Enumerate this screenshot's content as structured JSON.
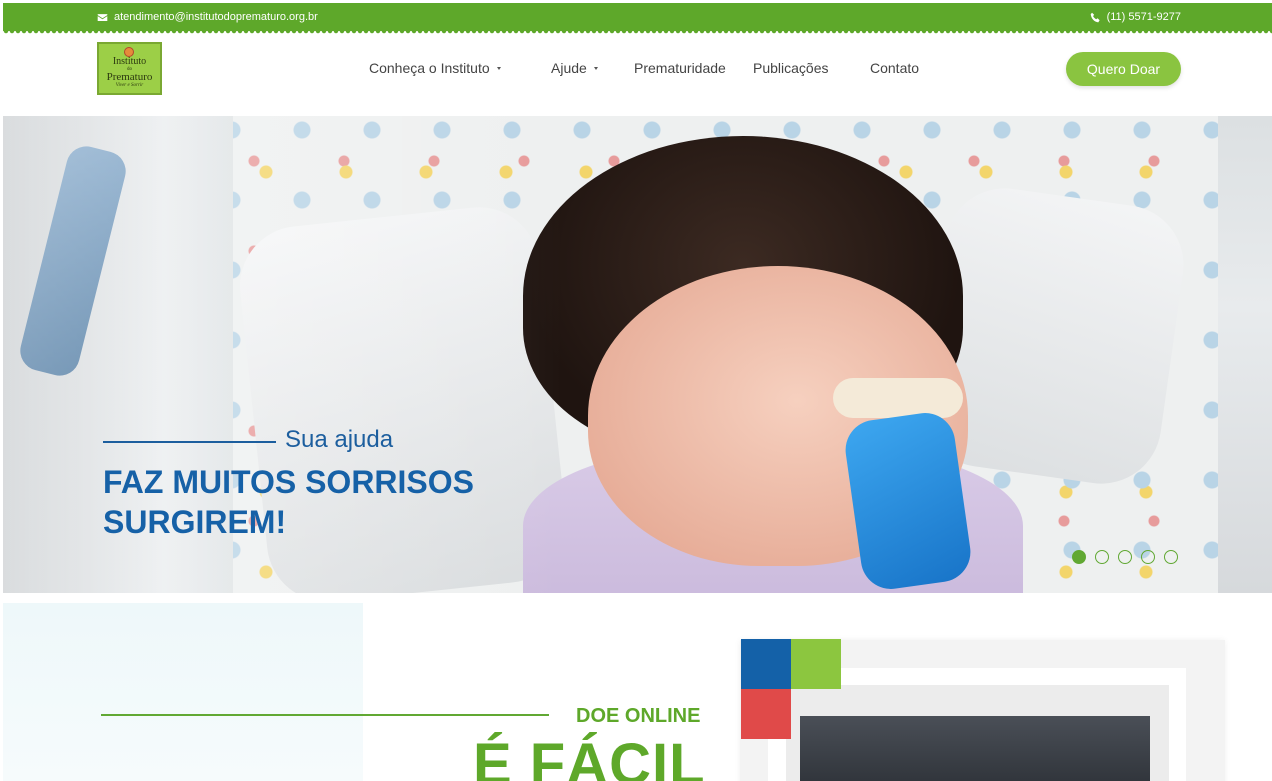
{
  "topbar": {
    "email": "atendimento@institutodoprematuro.org.br",
    "phone": "(11) 5571-9277"
  },
  "logo": {
    "line1": "Instituto",
    "line2": "do",
    "line3": "Prematuro",
    "line4": "Viver e Sorrir"
  },
  "nav": {
    "items": [
      {
        "label": "Conheça o Instituto",
        "has_dropdown": true
      },
      {
        "label": "Ajude",
        "has_dropdown": true
      },
      {
        "label": "Prematuridade",
        "has_dropdown": false
      },
      {
        "label": "Publicações",
        "has_dropdown": false
      },
      {
        "label": "Contato",
        "has_dropdown": false
      }
    ],
    "cta": "Quero Doar"
  },
  "hero": {
    "subtitle": "Sua ajuda",
    "title": "FAZ MUITOS SORRISOS SURGIREM!",
    "slides_total": 5,
    "active_slide": 1
  },
  "donate": {
    "label": "DOE ONLINE",
    "headline": "É FÁCIL"
  },
  "colors": {
    "green": "#5ea82a",
    "blue": "#1661a7",
    "red": "#e04a49",
    "light_green": "#8cc63f"
  },
  "icons": {
    "email": "envelope-icon",
    "phone": "phone-icon"
  }
}
